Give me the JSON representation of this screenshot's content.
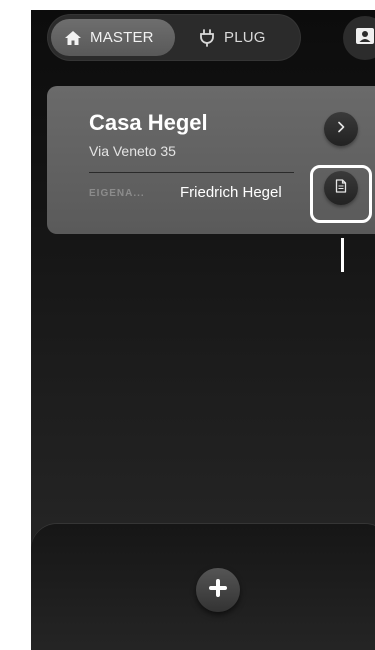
{
  "tabs": {
    "master_label": "MASTER",
    "plug_label": "PLUG",
    "active": "MASTER"
  },
  "icons": {
    "home": "home-icon",
    "plug": "plug-icon",
    "profile": "profile-card-icon",
    "chevron": "chevron-right-icon",
    "document": "document-icon",
    "add": "plus-icon"
  },
  "property_card": {
    "title": "Casa Hegel",
    "address": "Via Veneto 35",
    "owner_label": "EIGENA...",
    "owner_name": "Friedrich Hegel"
  },
  "colors": {
    "background": "#111111",
    "card": "#636363",
    "highlight": "#ffffff"
  }
}
